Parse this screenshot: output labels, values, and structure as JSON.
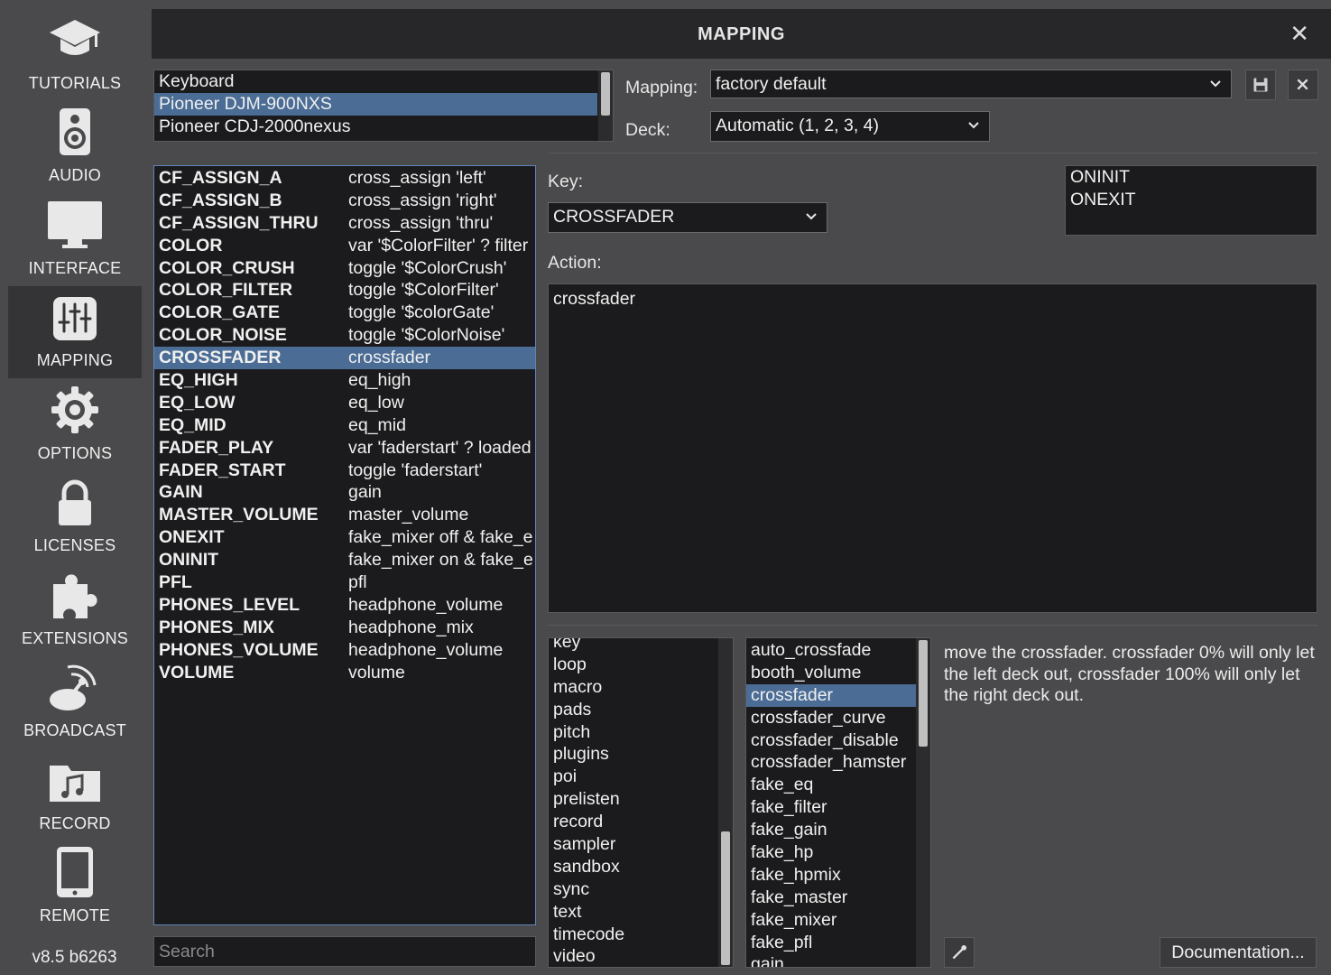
{
  "sidebar": {
    "items": [
      {
        "label": "TUTORIALS",
        "icon": "graduation-cap-icon"
      },
      {
        "label": "AUDIO",
        "icon": "speaker-icon"
      },
      {
        "label": "INTERFACE",
        "icon": "monitor-icon"
      },
      {
        "label": "MAPPING",
        "icon": "sliders-icon",
        "active": true
      },
      {
        "label": "OPTIONS",
        "icon": "gear-icon"
      },
      {
        "label": "LICENSES",
        "icon": "lock-icon"
      },
      {
        "label": "EXTENSIONS",
        "icon": "puzzle-icon"
      },
      {
        "label": "BROADCAST",
        "icon": "satellite-dish-icon"
      },
      {
        "label": "RECORD",
        "icon": "music-folder-icon"
      },
      {
        "label": "REMOTE",
        "icon": "tablet-icon"
      }
    ],
    "version": "v8.5 b6263"
  },
  "window": {
    "title": "MAPPING",
    "close_glyph": "✕"
  },
  "devices": {
    "items": [
      "Keyboard",
      "Pioneer DJM-900NXS",
      "Pioneer CDJ-2000nexus"
    ],
    "selected": "Pioneer DJM-900NXS"
  },
  "mapping": {
    "label": "Mapping:",
    "value": "factory default"
  },
  "deck": {
    "label": "Deck:",
    "value": "Automatic (1, 2, 3, 4)"
  },
  "functions": {
    "selected": "CROSSFADER",
    "rows": [
      {
        "key": "CF_ASSIGN_A",
        "action": "cross_assign 'left'"
      },
      {
        "key": "CF_ASSIGN_B",
        "action": "cross_assign 'right'"
      },
      {
        "key": "CF_ASSIGN_THRU",
        "action": "cross_assign 'thru'"
      },
      {
        "key": "COLOR",
        "action": "var '$ColorFilter' ? filter"
      },
      {
        "key": "COLOR_CRUSH",
        "action": "toggle '$ColorCrush'"
      },
      {
        "key": "COLOR_FILTER",
        "action": "toggle '$ColorFilter'"
      },
      {
        "key": "COLOR_GATE",
        "action": "toggle '$colorGate'"
      },
      {
        "key": "COLOR_NOISE",
        "action": "toggle '$ColorNoise'"
      },
      {
        "key": "CROSSFADER",
        "action": "crossfader"
      },
      {
        "key": "EQ_HIGH",
        "action": "eq_high"
      },
      {
        "key": "EQ_LOW",
        "action": "eq_low"
      },
      {
        "key": "EQ_MID",
        "action": "eq_mid"
      },
      {
        "key": "FADER_PLAY",
        "action": "var 'faderstart' ? loaded"
      },
      {
        "key": "FADER_START",
        "action": "toggle 'faderstart'"
      },
      {
        "key": "GAIN",
        "action": "gain"
      },
      {
        "key": "MASTER_VOLUME",
        "action": "master_volume"
      },
      {
        "key": "ONEXIT",
        "action": "fake_mixer off & fake_e"
      },
      {
        "key": "ONINIT",
        "action": "fake_mixer on & fake_e"
      },
      {
        "key": "PFL",
        "action": "pfl"
      },
      {
        "key": "PHONES_LEVEL",
        "action": "headphone_volume"
      },
      {
        "key": "PHONES_MIX",
        "action": "headphone_mix"
      },
      {
        "key": "PHONES_VOLUME",
        "action": "headphone_volume"
      },
      {
        "key": "VOLUME",
        "action": "volume"
      }
    ]
  },
  "search": {
    "placeholder": "Search",
    "value": ""
  },
  "key": {
    "label": "Key:",
    "value": "CROSSFADER"
  },
  "events": [
    "ONINIT",
    "ONEXIT"
  ],
  "action": {
    "label": "Action:",
    "value": "crossfader"
  },
  "categories": {
    "items": [
      "key",
      "loop",
      "macro",
      "pads",
      "pitch",
      "plugins",
      "poi",
      "prelisten",
      "record",
      "sampler",
      "sandbox",
      "sync",
      "text",
      "timecode",
      "video"
    ]
  },
  "verbs": {
    "selected": "crossfader",
    "items": [
      "auto_crossfade",
      "booth_volume",
      "crossfader",
      "crossfader_curve",
      "crossfader_disable",
      "crossfader_hamster",
      "fake_eq",
      "fake_filter",
      "fake_gain",
      "fake_hp",
      "fake_hpmix",
      "fake_master",
      "fake_mixer",
      "fake_pfl",
      "gain"
    ]
  },
  "help_text": "move the crossfader. crossfader 0% will only let the left deck out, crossfader 100% will only let the right deck out.",
  "documentation_button": "Documentation...",
  "colors": {
    "selection": "#4a6c95",
    "panel": "#1b1b1d",
    "titlebar": "#272729",
    "background": "#4a4a4c"
  }
}
